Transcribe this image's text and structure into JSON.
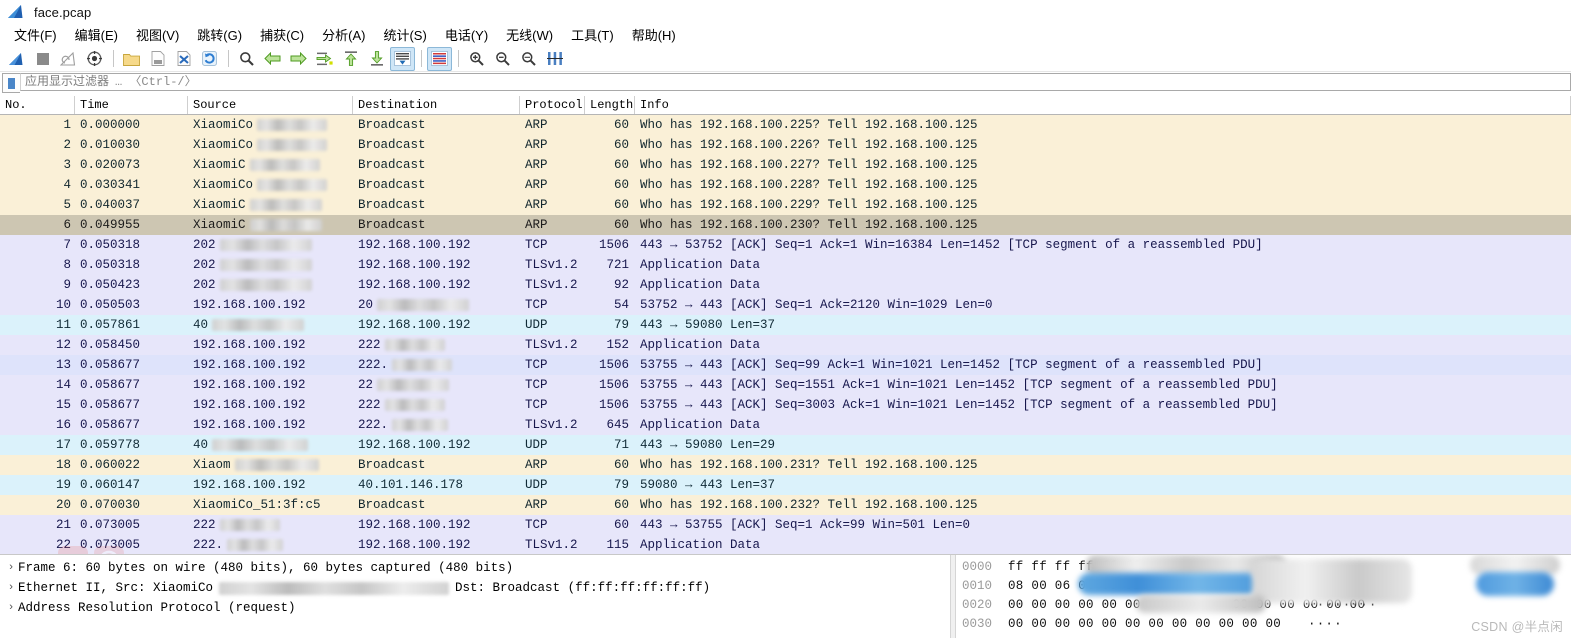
{
  "window": {
    "title": "face.pcap",
    "app_icon": "wireshark-shark-fin-icon"
  },
  "menu": [
    {
      "label": "文件(F)",
      "name": "menu-file"
    },
    {
      "label": "编辑(E)",
      "name": "menu-edit"
    },
    {
      "label": "视图(V)",
      "name": "menu-view"
    },
    {
      "label": "跳转(G)",
      "name": "menu-go"
    },
    {
      "label": "捕获(C)",
      "name": "menu-capture"
    },
    {
      "label": "分析(A)",
      "name": "menu-analyze"
    },
    {
      "label": "统计(S)",
      "name": "menu-statistics"
    },
    {
      "label": "电话(Y)",
      "name": "menu-telephony"
    },
    {
      "label": "无线(W)",
      "name": "menu-wireless"
    },
    {
      "label": "工具(T)",
      "name": "menu-tools"
    },
    {
      "label": "帮助(H)",
      "name": "menu-help"
    }
  ],
  "toolbar": {
    "icons": [
      "start-capture-icon",
      "stop-capture-icon",
      "restart-capture-icon",
      "capture-options-icon",
      "open-file-icon",
      "save-file-icon",
      "close-file-icon",
      "reload-file-icon",
      "find-packet-icon",
      "go-back-icon",
      "go-forward-icon",
      "go-to-packet-icon",
      "go-first-packet-icon",
      "go-last-packet-icon",
      "auto-scroll-icon",
      "colorize-icon",
      "zoom-in-icon",
      "zoom-out-icon",
      "zoom-reset-icon",
      "resize-columns-icon"
    ]
  },
  "filter": {
    "placeholder": "应用显示过滤器",
    "hint": "… 〈Ctrl-/〉",
    "value": "",
    "bookmark_icon": "filter-bookmark-icon"
  },
  "packet_list": {
    "columns": [
      {
        "label": "No.",
        "name": "column-no"
      },
      {
        "label": "Time",
        "name": "column-time"
      },
      {
        "label": "Source",
        "name": "column-source"
      },
      {
        "label": "Destination",
        "name": "column-destination"
      },
      {
        "label": "Protocol",
        "name": "column-protocol"
      },
      {
        "label": "Length",
        "name": "column-length"
      },
      {
        "label": "Info",
        "name": "column-info"
      }
    ],
    "rows": [
      {
        "no": "1",
        "time": "0.000000",
        "source": "XiaomiCo",
        "src_redacted": 70,
        "destination": "Broadcast",
        "dst_redacted": 0,
        "protocol": "ARP",
        "length": "60",
        "info": "Who has 192.168.100.225? Tell 192.168.100.125",
        "style": "bg-arp"
      },
      {
        "no": "2",
        "time": "0.010030",
        "source": "XiaomiCo",
        "src_redacted": 70,
        "destination": "Broadcast",
        "dst_redacted": 0,
        "protocol": "ARP",
        "length": "60",
        "info": "Who has 192.168.100.226? Tell 192.168.100.125",
        "style": "bg-arp"
      },
      {
        "no": "3",
        "time": "0.020073",
        "source": "XiaomiC",
        "src_redacted": 70,
        "destination": "Broadcast",
        "dst_redacted": 0,
        "protocol": "ARP",
        "length": "60",
        "info": "Who has 192.168.100.227? Tell 192.168.100.125",
        "style": "bg-arp"
      },
      {
        "no": "4",
        "time": "0.030341",
        "source": "XiaomiCo",
        "src_redacted": 70,
        "destination": "Broadcast",
        "dst_redacted": 0,
        "protocol": "ARP",
        "length": "60",
        "info": "Who has 192.168.100.228? Tell 192.168.100.125",
        "style": "bg-arp"
      },
      {
        "no": "5",
        "time": "0.040037",
        "source": "XiaomiC",
        "src_redacted": 72,
        "destination": "Broadcast",
        "dst_redacted": 0,
        "protocol": "ARP",
        "length": "60",
        "info": "Who has 192.168.100.229? Tell 192.168.100.125",
        "style": "bg-arp"
      },
      {
        "no": "6",
        "time": "0.049955",
        "source": "XiaomiC",
        "src_redacted": 72,
        "destination": "Broadcast",
        "dst_redacted": 0,
        "protocol": "ARP",
        "length": "60",
        "info": "Who has 192.168.100.230? Tell 192.168.100.125",
        "style": "bg-arp-sel",
        "selected": true
      },
      {
        "no": "7",
        "time": "0.050318",
        "source": "202",
        "src_redacted": 92,
        "destination": "192.168.100.192",
        "dst_redacted": 0,
        "protocol": "TCP",
        "length": "1506",
        "info": "443 → 53752 [ACK] Seq=1 Ack=1 Win=16384 Len=1452 [TCP segment of a reassembled PDU]",
        "style": "bg-tcp"
      },
      {
        "no": "8",
        "time": "0.050318",
        "source": "202",
        "src_redacted": 92,
        "destination": "192.168.100.192",
        "dst_redacted": 0,
        "protocol": "TLSv1.2",
        "length": "721",
        "info": "Application Data",
        "style": "bg-tcp"
      },
      {
        "no": "9",
        "time": "0.050423",
        "source": "202",
        "src_redacted": 92,
        "destination": "192.168.100.192",
        "dst_redacted": 0,
        "protocol": "TLSv1.2",
        "length": "92",
        "info": "Application Data",
        "style": "bg-tcp"
      },
      {
        "no": "10",
        "time": "0.050503",
        "source": "192.168.100.192",
        "src_redacted": 0,
        "destination": "20",
        "dst_redacted": 92,
        "protocol": "TCP",
        "length": "54",
        "info": "53752 → 443 [ACK] Seq=1 Ack=2120 Win=1029 Len=0",
        "style": "bg-tcp"
      },
      {
        "no": "11",
        "time": "0.057861",
        "source": "40",
        "src_redacted": 92,
        "destination": "192.168.100.192",
        "dst_redacted": 0,
        "protocol": "UDP",
        "length": "79",
        "info": "443 → 59080 Len=37",
        "style": "bg-udp"
      },
      {
        "no": "12",
        "time": "0.058450",
        "source": "192.168.100.192",
        "src_redacted": 0,
        "destination": "222",
        "dst_redacted": 60,
        "protocol": "TLSv1.2",
        "length": "152",
        "info": "Application Data",
        "style": "bg-tcp"
      },
      {
        "no": "13",
        "time": "0.058677",
        "source": "192.168.100.192",
        "src_redacted": 0,
        "destination": "222.",
        "dst_redacted": 60,
        "protocol": "TCP",
        "length": "1506",
        "info": "53755 → 443 [ACK] Seq=99 Ack=1 Win=1021 Len=1452 [TCP segment of a reassembled PDU]",
        "style": "bg-tcp-hi"
      },
      {
        "no": "14",
        "time": "0.058677",
        "source": "192.168.100.192",
        "src_redacted": 0,
        "destination": "22",
        "dst_redacted": 72,
        "protocol": "TCP",
        "length": "1506",
        "info": "53755 → 443 [ACK] Seq=1551 Ack=1 Win=1021 Len=1452 [TCP segment of a reassembled PDU]",
        "style": "bg-tcp"
      },
      {
        "no": "15",
        "time": "0.058677",
        "source": "192.168.100.192",
        "src_redacted": 0,
        "destination": "222",
        "dst_redacted": 60,
        "protocol": "TCP",
        "length": "1506",
        "info": "53755 → 443 [ACK] Seq=3003 Ack=1 Win=1021 Len=1452 [TCP segment of a reassembled PDU]",
        "style": "bg-tcp"
      },
      {
        "no": "16",
        "time": "0.058677",
        "source": "192.168.100.192",
        "src_redacted": 0,
        "destination": "222.",
        "dst_redacted": 56,
        "protocol": "TLSv1.2",
        "length": "645",
        "info": "Application Data",
        "style": "bg-tcp"
      },
      {
        "no": "17",
        "time": "0.059778",
        "source": "40",
        "src_redacted": 96,
        "destination": "192.168.100.192",
        "dst_redacted": 0,
        "protocol": "UDP",
        "length": "71",
        "info": "443 → 59080 Len=29",
        "style": "bg-udp"
      },
      {
        "no": "18",
        "time": "0.060022",
        "source": "Xiaom",
        "src_redacted": 84,
        "destination": "Broadcast",
        "dst_redacted": 0,
        "protocol": "ARP",
        "length": "60",
        "info": "Who has 192.168.100.231? Tell 192.168.100.125",
        "style": "bg-arp"
      },
      {
        "no": "19",
        "time": "0.060147",
        "source": "192.168.100.192",
        "src_redacted": 0,
        "destination": "40.101.146.178",
        "dst_redacted": 0,
        "protocol": "UDP",
        "length": "79",
        "info": "59080 → 443 Len=37",
        "style": "bg-udp"
      },
      {
        "no": "20",
        "time": "0.070030",
        "source": "XiaomiCo_51:3f:c5",
        "src_redacted": 0,
        "destination": "Broadcast",
        "dst_redacted": 0,
        "protocol": "ARP",
        "length": "60",
        "info": "Who has 192.168.100.232? Tell 192.168.100.125",
        "style": "bg-arp"
      },
      {
        "no": "21",
        "time": "0.073005",
        "source": "222",
        "src_redacted": 60,
        "destination": "192.168.100.192",
        "dst_redacted": 0,
        "protocol": "TCP",
        "length": "60",
        "info": "443 → 53755 [ACK] Seq=1 Ack=99 Win=501 Len=0",
        "style": "bg-tcp"
      },
      {
        "no": "22",
        "time": "0.073005",
        "source": "222.",
        "src_redacted": 56,
        "destination": "192.168.100.192",
        "dst_redacted": 0,
        "protocol": "TLSv1.2",
        "length": "115",
        "info": "Application Data",
        "style": "bg-tcp"
      }
    ]
  },
  "packet_detail": {
    "rows": [
      {
        "twisty": "›",
        "text": "Frame 6: 60 bytes on wire (480 bits), 60 bytes captured (480 bits)",
        "name": "detail-frame",
        "redact_after": 0
      },
      {
        "twisty": "›",
        "text": "Ethernet II, Src: XiaomiCo",
        "tail": "Dst: Broadcast (ff:ff:ff:ff:ff:ff)",
        "name": "detail-ethernet",
        "redact_after": 215
      },
      {
        "twisty": "›",
        "text": "Address Resolution Protocol (request)",
        "name": "detail-arp",
        "redact_after": 0
      }
    ]
  },
  "hex_dump": {
    "rows": [
      {
        "offset": "0000",
        "bytes": "ff ff ff ff ff ff",
        "ascii": "·······"
      },
      {
        "offset": "0010",
        "bytes": "08 00 06 04 00 01",
        "ascii": "······"
      },
      {
        "offset": "0020",
        "bytes": "00 00 00 00 00 00",
        "bytes_tail": "00 00 00 00 00 00",
        "ascii": "········"
      },
      {
        "offset": "0030",
        "bytes": "00 00 00 00 00 00 00 00  00 00 00 00",
        "ascii": "····"
      }
    ]
  },
  "watermark": {
    "text": "CSDN @半点闲"
  },
  "colors": {
    "arp_row": "#faf0d7",
    "arp_selected": "#cdc6b2",
    "tcp_row": "#e7e6fa",
    "udp_row": "#dbf2fb",
    "accent": "#1b75bb"
  }
}
